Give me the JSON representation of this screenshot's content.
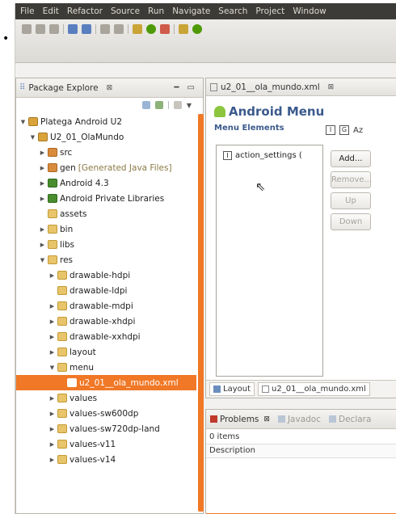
{
  "menubar": {
    "items": [
      "File",
      "Edit",
      "Refactor",
      "Source",
      "Run",
      "Navigate",
      "Search",
      "Project",
      "Window"
    ]
  },
  "package_explorer": {
    "tab_label": "Package Explore",
    "tree": [
      {
        "label": "Platega Android U2",
        "level": 0,
        "icon": "project",
        "expanded": true
      },
      {
        "label": "U2_01_OlaMundo",
        "level": 1,
        "icon": "project",
        "expanded": true
      },
      {
        "label": "src",
        "level": 2,
        "icon": "src-folder",
        "expanded": false
      },
      {
        "label": "gen",
        "extra": "[Generated Java Files]",
        "level": 2,
        "icon": "src-folder",
        "expanded": false
      },
      {
        "label": "Android 4.3",
        "level": 2,
        "icon": "library",
        "expanded": false
      },
      {
        "label": "Android Private Libraries",
        "level": 2,
        "icon": "library",
        "expanded": false
      },
      {
        "label": "assets",
        "level": 2,
        "icon": "folder",
        "leaf": true
      },
      {
        "label": "bin",
        "level": 2,
        "icon": "folder",
        "expanded": false
      },
      {
        "label": "libs",
        "level": 2,
        "icon": "folder",
        "expanded": false
      },
      {
        "label": "res",
        "level": 2,
        "icon": "folder",
        "expanded": true
      },
      {
        "label": "drawable-hdpi",
        "level": 3,
        "icon": "folder",
        "expanded": false
      },
      {
        "label": "drawable-ldpi",
        "level": 3,
        "icon": "folder",
        "leaf": true
      },
      {
        "label": "drawable-mdpi",
        "level": 3,
        "icon": "folder",
        "expanded": false
      },
      {
        "label": "drawable-xhdpi",
        "level": 3,
        "icon": "folder",
        "expanded": false
      },
      {
        "label": "drawable-xxhdpi",
        "level": 3,
        "icon": "folder",
        "expanded": false
      },
      {
        "label": "layout",
        "level": 3,
        "icon": "folder",
        "expanded": false
      },
      {
        "label": "menu",
        "level": 3,
        "icon": "folder",
        "expanded": true
      },
      {
        "label": "u2_01__ola_mundo.xml",
        "level": 4,
        "icon": "file",
        "leaf": true,
        "selected": true
      },
      {
        "label": "values",
        "level": 3,
        "icon": "folder",
        "expanded": false
      },
      {
        "label": "values-sw600dp",
        "level": 3,
        "icon": "folder",
        "expanded": false
      },
      {
        "label": "values-sw720dp-land",
        "level": 3,
        "icon": "folder",
        "expanded": false
      },
      {
        "label": "values-v11",
        "level": 3,
        "icon": "folder",
        "expanded": false
      },
      {
        "label": "values-v14",
        "level": 3,
        "icon": "folder",
        "expanded": false
      }
    ]
  },
  "editor": {
    "tab_label": "u2_01__ola_mundo.xml",
    "title": "Android Menu",
    "section": "Menu Elements",
    "header_icons": [
      "I",
      "G",
      "Az"
    ],
    "items": [
      {
        "label": "action_settings (",
        "icon": "I"
      }
    ],
    "buttons": {
      "add": "Add...",
      "remove": "Remove...",
      "up": "Up",
      "down": "Down"
    },
    "bottom_tabs": [
      "Layout",
      "u2_01__ola_mundo.xml"
    ]
  },
  "problems": {
    "tabs": [
      "Problems",
      "Javadoc",
      "Declara"
    ],
    "count": "0 items",
    "column": "Description"
  },
  "colors": {
    "selection": "#f07826",
    "title": "#3b5a8c",
    "menubar": "#3c3b37"
  }
}
